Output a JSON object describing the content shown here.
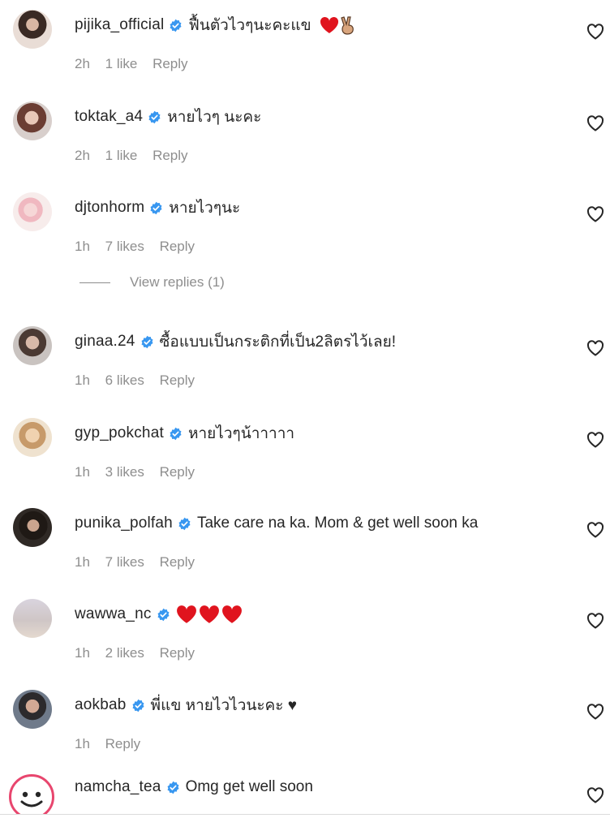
{
  "comments": [
    {
      "username": "pijika_official",
      "text": "ฟื้นตัวไวๆนะคะแข",
      "time": "2h",
      "likes": "1 like",
      "reply": "Reply",
      "emoji": "❤️✌🏼"
    },
    {
      "username": "toktak_a4",
      "text": "หายไวๆ นะคะ",
      "time": "2h",
      "likes": "1 like",
      "reply": "Reply"
    },
    {
      "username": "djtonhorm",
      "text": "หายไวๆนะ",
      "time": "1h",
      "likes": "7 likes",
      "reply": "Reply"
    },
    {
      "username": "ginaa.24",
      "text": "ซื้อแบบเป็นกระติกที่เป็น2ลิตรไว้เลย!",
      "time": "1h",
      "likes": "6 likes",
      "reply": "Reply"
    },
    {
      "username": "gyp_pokchat",
      "text": "หายไวๆน้าาาาา",
      "time": "1h",
      "likes": "3 likes",
      "reply": "Reply"
    },
    {
      "username": "punika_polfah",
      "text": "Take care na ka. Mom & get well soon ka",
      "time": "1h",
      "likes": "7 likes",
      "reply": "Reply"
    },
    {
      "username": "wawwa_nc",
      "text": "",
      "time": "1h",
      "likes": "2 likes",
      "reply": "Reply",
      "emoji": "❤️❤️❤️"
    },
    {
      "username": "aokbab",
      "text": "พี่แข หายไวไวนะคะ ♥",
      "time": "1h",
      "likes": "",
      "reply": "Reply"
    },
    {
      "username": "namcha_tea",
      "text": "Omg get well soon",
      "time": "",
      "likes": "",
      "reply": ""
    }
  ],
  "view_replies": "View replies (1)",
  "colors": {
    "verified": "#3897f0",
    "secondary_text": "#8e8e8e",
    "heart": "#e0141e"
  },
  "icons": {
    "verified": "verified-badge-icon",
    "like": "heart-outline-icon"
  }
}
